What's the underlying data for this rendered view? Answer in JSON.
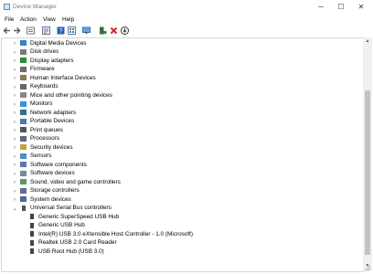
{
  "window": {
    "title": "Device Manager",
    "minimize_icon": "─",
    "maximize_icon": "☐",
    "close_icon": "✕"
  },
  "menu": [
    "File",
    "Action",
    "View",
    "Help"
  ],
  "toolbar": [
    "back-arrow-icon",
    "forward-arrow-icon",
    "show-hidden-icon",
    "properties-icon",
    "help-icon",
    "view-by-type-icon",
    "monitor-icon",
    "scan-hardware-icon",
    "uninstall-icon",
    "update-driver-icon"
  ],
  "tree": [
    {
      "label": "Digital Media Devices",
      "level": 0,
      "state": "collapsed",
      "icon": "media-device-icon"
    },
    {
      "label": "Disk drives",
      "level": 0,
      "state": "collapsed",
      "icon": "disk-drive-icon"
    },
    {
      "label": "Display adapters",
      "level": 0,
      "state": "collapsed",
      "icon": "display-adapter-icon"
    },
    {
      "label": "Firmware",
      "level": 0,
      "state": "collapsed",
      "icon": "firmware-icon"
    },
    {
      "label": "Human Interface Devices",
      "level": 0,
      "state": "collapsed",
      "icon": "hid-icon"
    },
    {
      "label": "Keyboards",
      "level": 0,
      "state": "collapsed",
      "icon": "keyboard-icon"
    },
    {
      "label": "Mice and other pointing devices",
      "level": 0,
      "state": "collapsed",
      "icon": "mouse-icon"
    },
    {
      "label": "Monitors",
      "level": 0,
      "state": "collapsed",
      "icon": "monitor-icon"
    },
    {
      "label": "Network adapters",
      "level": 0,
      "state": "collapsed",
      "icon": "network-adapter-icon"
    },
    {
      "label": "Portable Devices",
      "level": 0,
      "state": "collapsed",
      "icon": "portable-device-icon"
    },
    {
      "label": "Print queues",
      "level": 0,
      "state": "collapsed",
      "icon": "printer-icon"
    },
    {
      "label": "Processors",
      "level": 0,
      "state": "collapsed",
      "icon": "processor-icon"
    },
    {
      "label": "Security devices",
      "level": 0,
      "state": "collapsed",
      "icon": "security-device-icon"
    },
    {
      "label": "Sensors",
      "level": 0,
      "state": "collapsed",
      "icon": "sensor-icon"
    },
    {
      "label": "Software components",
      "level": 0,
      "state": "collapsed",
      "icon": "software-component-icon"
    },
    {
      "label": "Software devices",
      "level": 0,
      "state": "collapsed",
      "icon": "software-device-icon"
    },
    {
      "label": "Sound, video and game controllers",
      "level": 0,
      "state": "collapsed",
      "icon": "sound-icon"
    },
    {
      "label": "Storage controllers",
      "level": 0,
      "state": "collapsed",
      "icon": "storage-controller-icon"
    },
    {
      "label": "System devices",
      "level": 0,
      "state": "collapsed",
      "icon": "system-device-icon"
    },
    {
      "label": "Universal Serial Bus controllers",
      "level": 0,
      "state": "expanded",
      "icon": "usb-icon"
    },
    {
      "label": "Generic SuperSpeed USB Hub",
      "level": 1,
      "icon": "usb-device-icon"
    },
    {
      "label": "Generic USB Hub",
      "level": 1,
      "icon": "usb-device-icon"
    },
    {
      "label": "Intel(R) USB 3.0 eXtensible Host Controller - 1.0 (Microsoft)",
      "level": 1,
      "icon": "usb-device-icon"
    },
    {
      "label": "Realtek USB 2.0 Card Reader",
      "level": 1,
      "icon": "usb-device-icon"
    },
    {
      "label": "USB Root Hub (USB 3.0)",
      "level": 1,
      "icon": "usb-device-icon"
    }
  ],
  "glyphs": {
    "collapsed": "›",
    "expanded": "⌄",
    "scroll_up": "▲",
    "scroll_down": "▼"
  },
  "colors": {
    "accent": "#1e6fc5",
    "red": "#d3232a",
    "green": "#2f8a3c",
    "gray": "#8a8a8a"
  }
}
